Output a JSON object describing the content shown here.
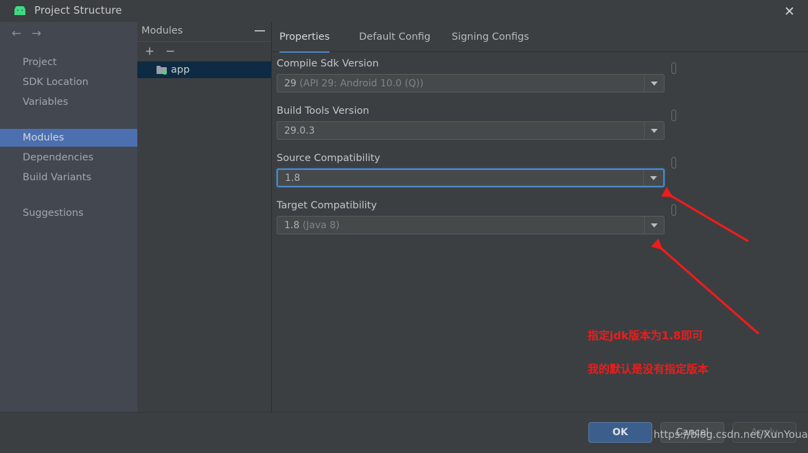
{
  "window": {
    "title": "Project Structure",
    "app_icon": "android-robot-icon",
    "close_icon": "✕"
  },
  "sidebar": {
    "back_icon": "←",
    "forward_icon": "→",
    "items": [
      {
        "label": "Project",
        "selected": false
      },
      {
        "label": "SDK Location",
        "selected": false
      },
      {
        "label": "Variables",
        "selected": false
      },
      {
        "label": "Modules",
        "selected": true
      },
      {
        "label": "Dependencies",
        "selected": false
      },
      {
        "label": "Build Variants",
        "selected": false
      },
      {
        "label": "Suggestions",
        "selected": false
      }
    ]
  },
  "modules_panel": {
    "title": "Modules",
    "minimize_icon": "−",
    "add_icon": "+",
    "remove_icon": "−",
    "modules": [
      {
        "name": "app",
        "selected": true,
        "icon": "folder-icon"
      }
    ]
  },
  "tabs": [
    {
      "label": "Properties",
      "active": true
    },
    {
      "label": "Default Config",
      "active": false
    },
    {
      "label": "Signing Configs",
      "active": false
    }
  ],
  "fields": [
    {
      "label": "Compile Sdk Version",
      "value": "29",
      "hint": " (API 29: Android 10.0 (Q))",
      "focused": false
    },
    {
      "label": "Build Tools Version",
      "value": "29.0.3",
      "hint": "",
      "focused": false
    },
    {
      "label": "Source Compatibility",
      "value": "1.8",
      "hint": "",
      "focused": true
    },
    {
      "label": "Target Compatibility",
      "value": "1.8",
      "hint": " (Java 8)",
      "focused": false
    }
  ],
  "footer": {
    "ok_label": "OK",
    "cancel_label": "Cancel",
    "apply_label": "Apply",
    "watermark": "https://blog.csdn.net/XunYoua"
  },
  "annotations": {
    "color": "#ee1c1c",
    "line1": "指定jdk版本为1.8即可",
    "line2": "我的默认是没有指定版本"
  }
}
